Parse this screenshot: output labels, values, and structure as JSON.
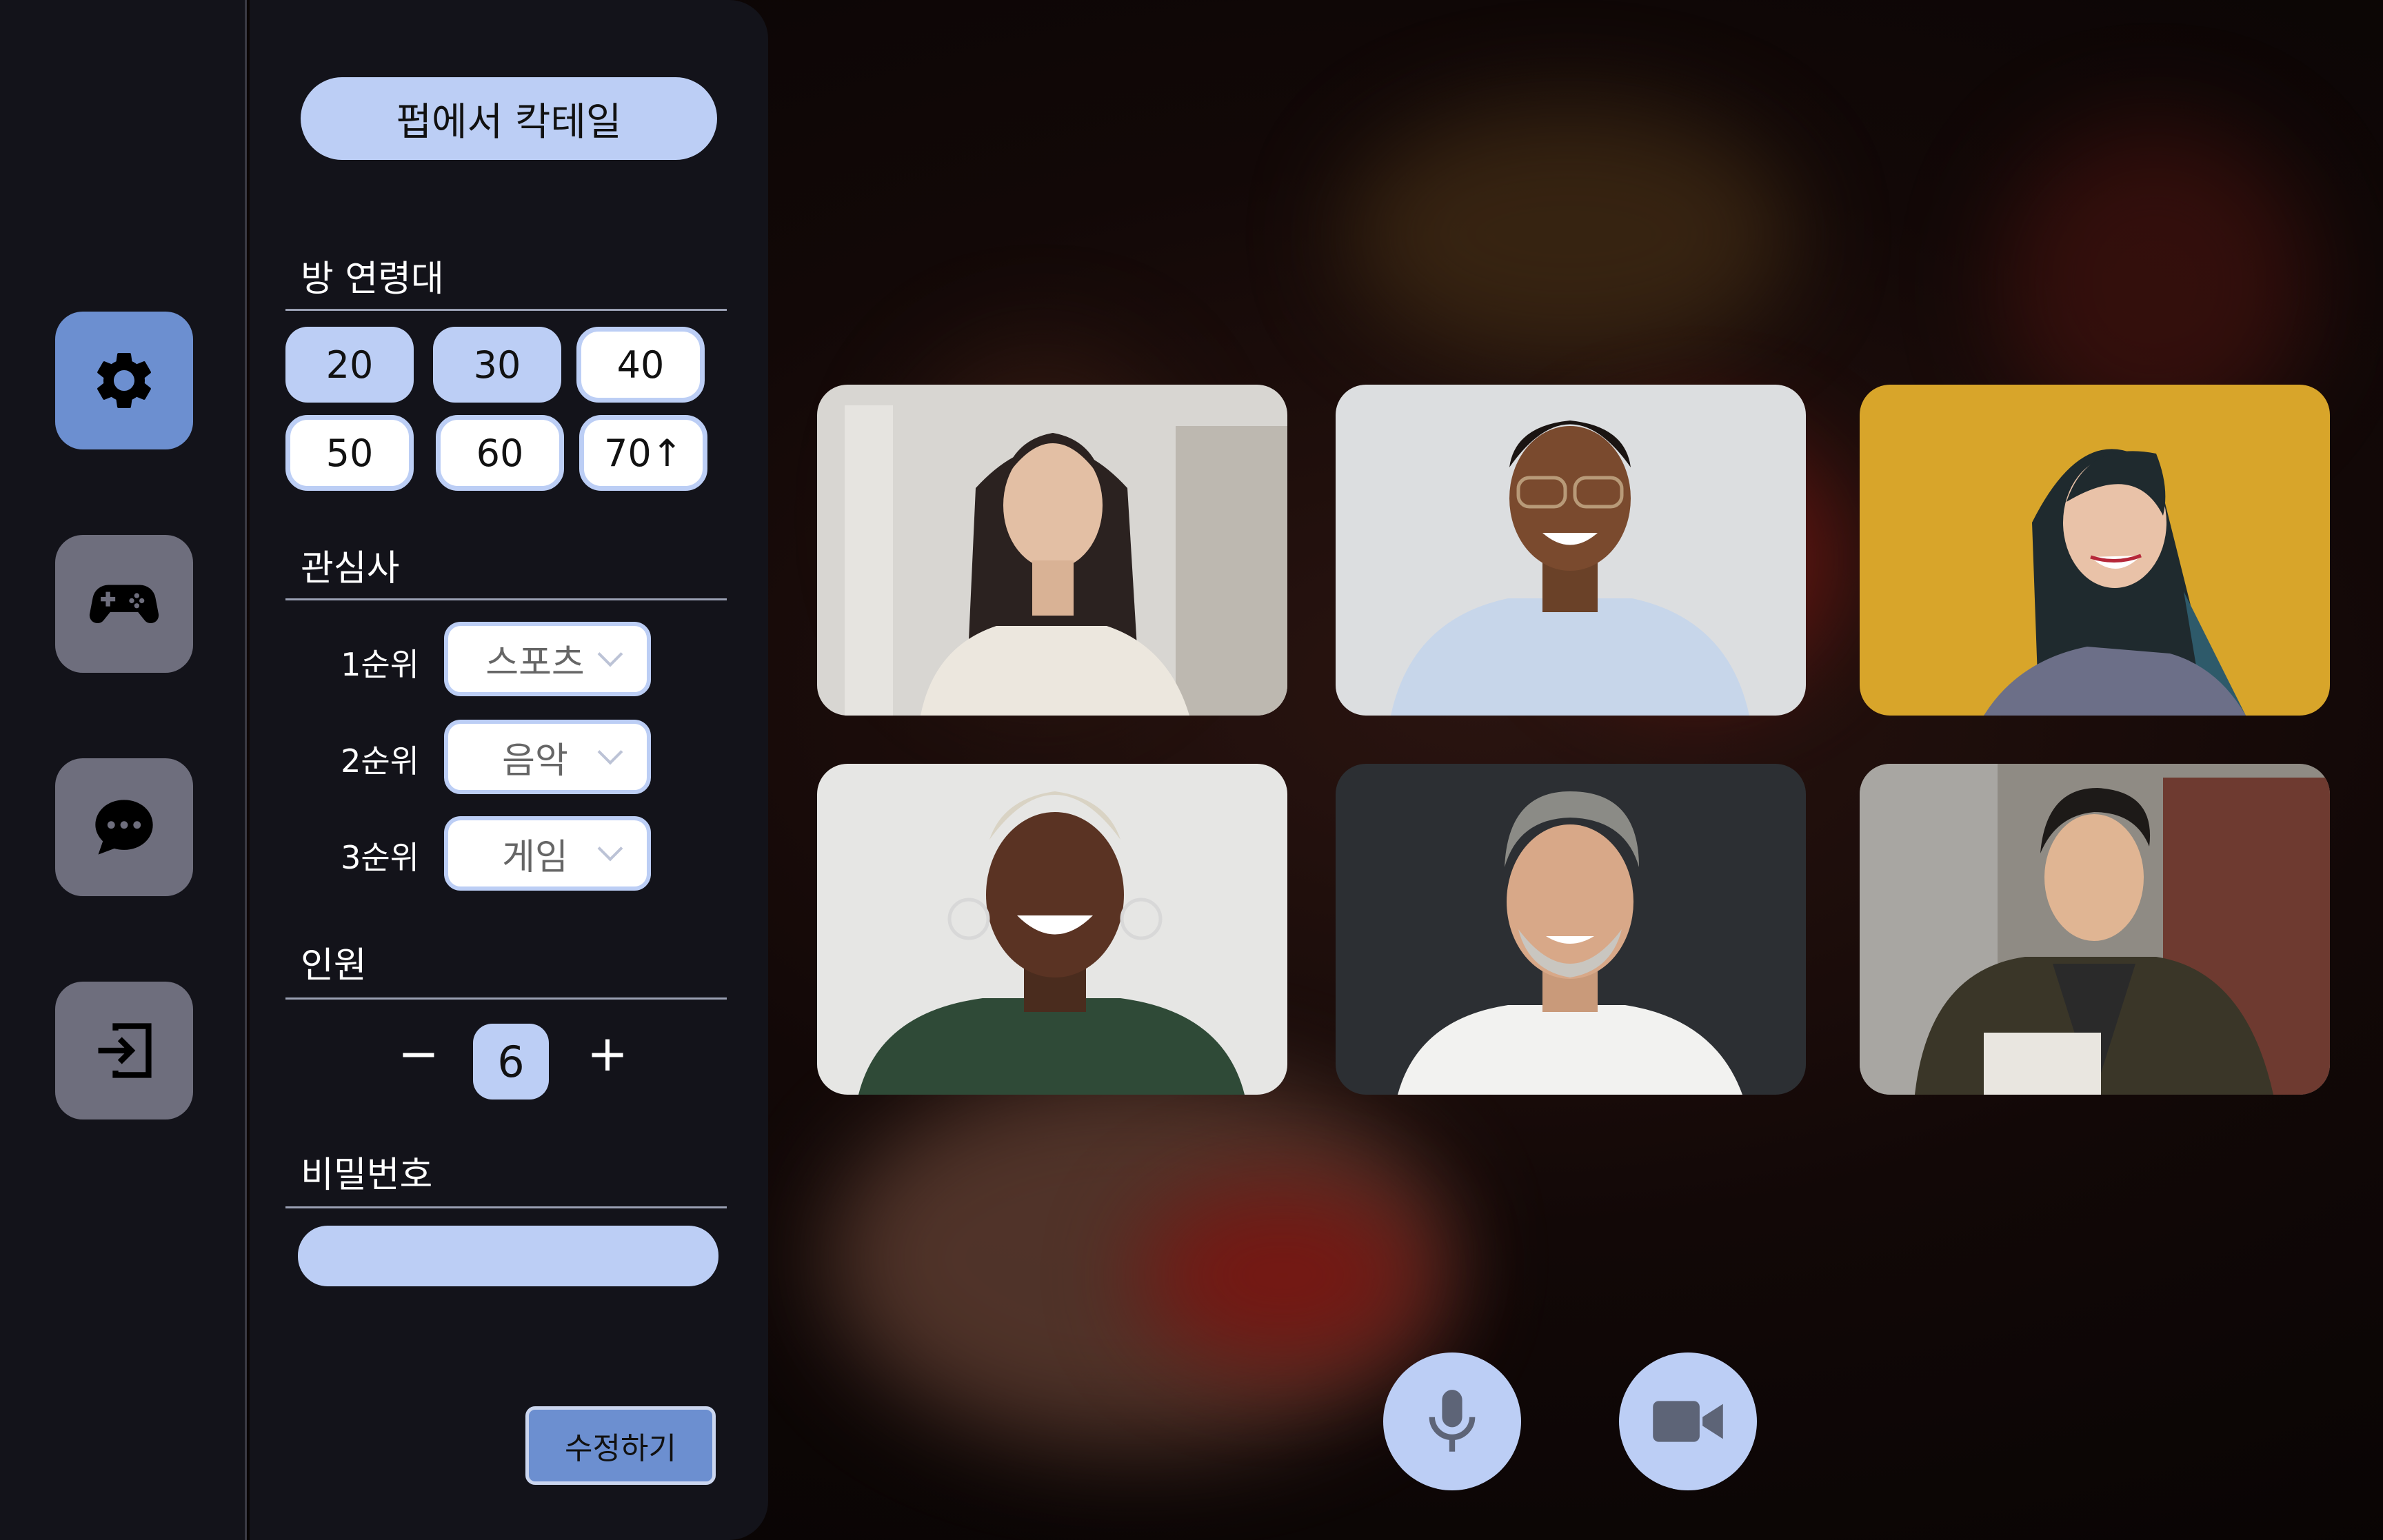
{
  "rail": {
    "items": [
      {
        "icon": "gear-icon",
        "active": true
      },
      {
        "icon": "gamepad-icon",
        "active": false
      },
      {
        "icon": "chat-icon",
        "active": false
      },
      {
        "icon": "exit-icon",
        "active": false
      }
    ]
  },
  "panel": {
    "room_title": "펍에서 칵테일",
    "age": {
      "title": "방 연령대",
      "options": [
        "20",
        "30",
        "40",
        "50",
        "60",
        "70↑"
      ],
      "selected": [
        "20",
        "30"
      ]
    },
    "interests": {
      "title": "관심사",
      "ranks": [
        {
          "label": "1순위",
          "value": "스포츠"
        },
        {
          "label": "2순위",
          "value": "음악"
        },
        {
          "label": "3순위",
          "value": "게임"
        }
      ]
    },
    "members": {
      "title": "인원",
      "minus": "−",
      "count": "6",
      "plus": "+"
    },
    "password": {
      "title": "비밀번호",
      "value": ""
    },
    "edit_button": "수정하기"
  },
  "participants": [
    {
      "name": "participant-1"
    },
    {
      "name": "participant-2"
    },
    {
      "name": "participant-3"
    },
    {
      "name": "participant-4"
    },
    {
      "name": "participant-5"
    },
    {
      "name": "participant-6"
    }
  ],
  "controls": {
    "mic_icon": "microphone-icon",
    "camera_icon": "video-camera-icon"
  },
  "colors": {
    "accent": "#6c8fd0",
    "light_accent": "#bccef5",
    "panel_bg": "#13131a",
    "inactive_btn": "#6e6e7d"
  }
}
